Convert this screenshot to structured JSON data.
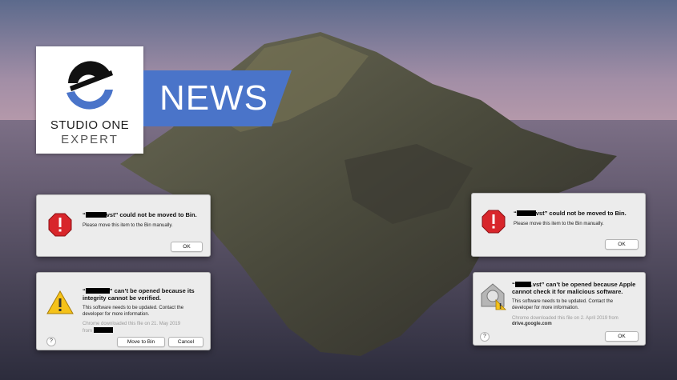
{
  "logo": {
    "line1": "STUDIO ONE",
    "line2": "EXPERT"
  },
  "banner": {
    "text": "NEWS"
  },
  "dialogs": {
    "bin_left": {
      "title_before": "“",
      "title_after": "vst” could not be moved to Bin.",
      "message": "Please move this item to the Bin manually.",
      "ok": "OK"
    },
    "bin_right": {
      "title_before": "“",
      "title_after": "vst” could not be moved to Bin.",
      "message": "Please move this item to the Bin manually.",
      "ok": "OK"
    },
    "integrity": {
      "title_line1_after": "” can’t be opened because its",
      "title_line2": "integrity cannot be verified.",
      "message_line1": "This software needs to be updated. Contact the",
      "message_line2": "developer for more information.",
      "meta_line1": "Chrome downloaded this file on 21. May 2019",
      "meta_line2": "from",
      "help": "?",
      "move": "Move to Bin",
      "cancel": "Cancel"
    },
    "apple": {
      "title_line1_after": ".vst” can’t be opened because Apple",
      "title_line2": "cannot check it for malicious software.",
      "message_line1": "This software needs to be updated. Contact the",
      "message_line2": "developer for more information.",
      "meta_line1": "Chrome downloaded this file on 2. April 2019 from",
      "meta_source": "drive.google.com",
      "help": "?",
      "ok": "OK"
    }
  },
  "colors": {
    "banner": "#4a74c9",
    "stop": "#d8262b",
    "warning": "#f5c219"
  }
}
